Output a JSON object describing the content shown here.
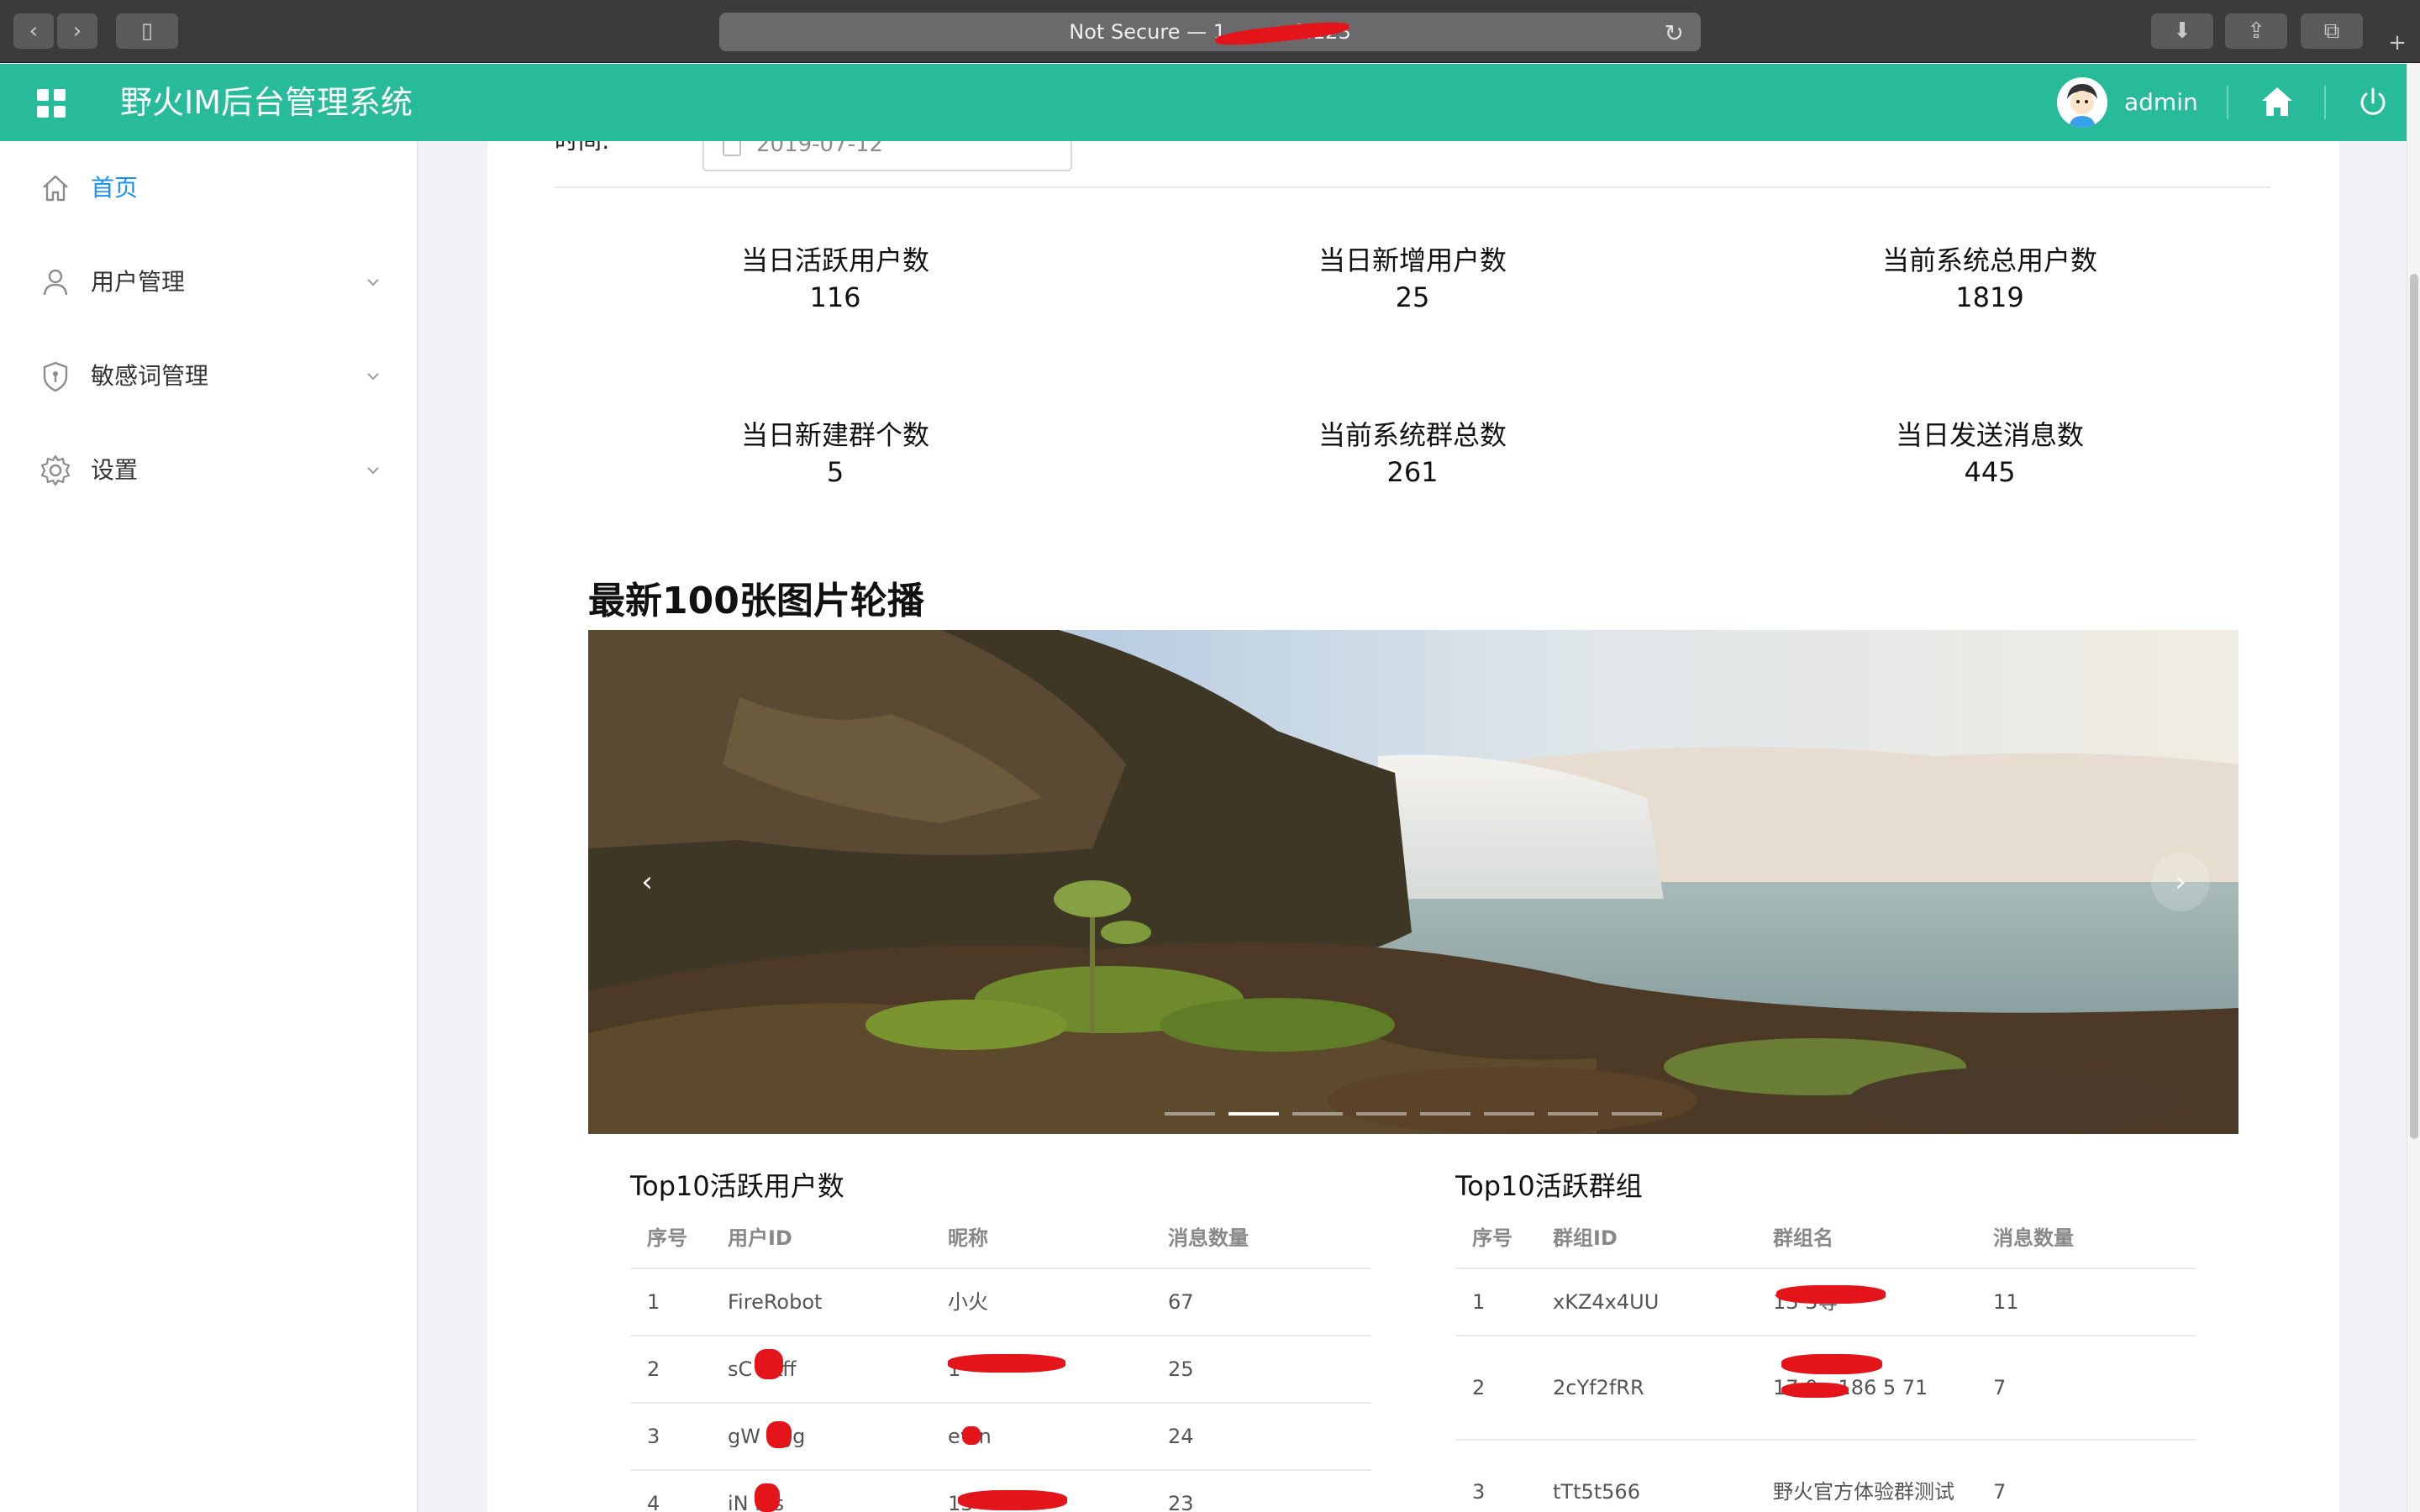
{
  "browser": {
    "address_text": "Not Secure — 1",
    "address_suffix": "8.123"
  },
  "header": {
    "title": "野火IM后台管理系统",
    "username": "admin"
  },
  "sidebar": {
    "items": [
      {
        "label": "首页",
        "active": true,
        "icon": "home-icon"
      },
      {
        "label": "用户管理",
        "active": false,
        "icon": "user-icon"
      },
      {
        "label": "敏感词管理",
        "active": false,
        "icon": "shield-icon"
      },
      {
        "label": "设置",
        "active": false,
        "icon": "gear-icon"
      }
    ]
  },
  "filter": {
    "label": "时间:",
    "date_value": "2019-07-12"
  },
  "stats": [
    {
      "title": "当日活跃用户数",
      "value": "116"
    },
    {
      "title": "当日新增用户数",
      "value": "25"
    },
    {
      "title": "当前系统总用户数",
      "value": "1819"
    },
    {
      "title": "当日新建群个数",
      "value": "5"
    },
    {
      "title": "当前系统群总数",
      "value": "261"
    },
    {
      "title": "当日发送消息数",
      "value": "445"
    }
  ],
  "carousel": {
    "title": "最新100张图片轮播",
    "prev": "‹",
    "next": "›",
    "dot_count": 8,
    "active_dot": 1
  },
  "top_users": {
    "title": "Top10活跃用户数",
    "columns": [
      "序号",
      "用户ID",
      "昵称",
      "消息数量"
    ],
    "rows": [
      [
        "1",
        "FireRobot",
        "小火",
        "67"
      ],
      [
        "2",
        "sC  sKff",
        "1",
        "25"
      ],
      [
        "3",
        "gW  6gg",
        "ev  n",
        "24"
      ],
      [
        "4",
        "iN  rss",
        "13",
        "23"
      ]
    ]
  },
  "top_groups": {
    "title": "Top10活跃群组",
    "columns": [
      "序号",
      "群组ID",
      "群组名",
      "消息数量"
    ],
    "rows": [
      [
        "1",
        "xKZ4x4UU",
        "13      3等",
        "11"
      ],
      [
        "2",
        "2cYf2fRR",
        "17     0、186 5     71",
        "7"
      ],
      [
        "3",
        "tTt5t566",
        "野火官方体验群测试",
        "7"
      ]
    ]
  },
  "colors": {
    "brand": "#27bb99",
    "active": "#1890ff"
  }
}
